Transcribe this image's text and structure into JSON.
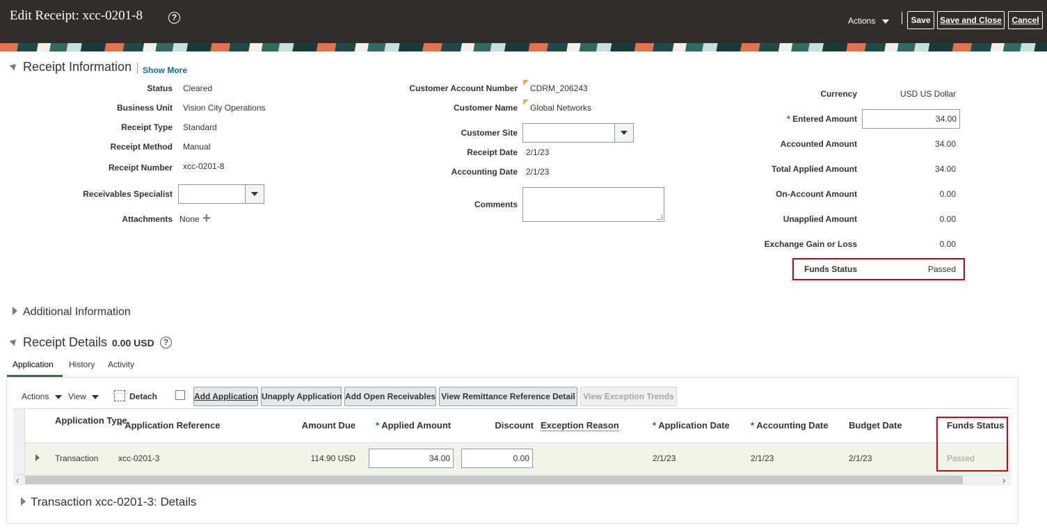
{
  "header": {
    "title": "Edit Receipt: xcc-0201-8",
    "actions_label": "Actions",
    "save_label": "Save",
    "save_close_label": "Save and Close",
    "cancel_label": "Cancel"
  },
  "receipt_info": {
    "title": "Receipt Information",
    "show_more": "Show More",
    "left": [
      {
        "label": "Status",
        "value": "Cleared"
      },
      {
        "label": "Business Unit",
        "value": "Vision City Operations"
      },
      {
        "label": "Receipt Type",
        "value": "Standard"
      },
      {
        "label": "Receipt Method",
        "value": "Manual"
      },
      {
        "label": "Receipt Number",
        "value": "xcc-0201-8"
      }
    ],
    "receivables_specialist": {
      "label": "Receivables Specialist",
      "value": ""
    },
    "attachments": {
      "label": "Attachments",
      "value": "None"
    },
    "middle": {
      "customer_account_number": {
        "label": "Customer Account Number",
        "value": "CDRM_206243"
      },
      "customer_name": {
        "label": "Customer Name",
        "value": "Global Networks"
      },
      "customer_site": {
        "label": "Customer Site",
        "value": ""
      },
      "receipt_date": {
        "label": "Receipt Date",
        "value": "2/1/23"
      },
      "accounting_date": {
        "label": "Accounting Date",
        "value": "2/1/23"
      },
      "comments": {
        "label": "Comments",
        "value": ""
      }
    },
    "right": {
      "currency": {
        "label": "Currency",
        "value": "USD US Dollar"
      },
      "entered_amount": {
        "label": "Entered Amount",
        "value": "34.00",
        "required_mark": "*"
      },
      "accounted_amount": {
        "label": "Accounted Amount",
        "value": "34.00"
      },
      "total_applied_amount": {
        "label": "Total Applied Amount",
        "value": "34.00"
      },
      "on_account_amount": {
        "label": "On-Account Amount",
        "value": "0.00"
      },
      "unapplied_amount": {
        "label": "Unapplied Amount",
        "value": "0.00"
      },
      "exchange_gain_loss": {
        "label": "Exchange Gain or Loss",
        "value": "0.00"
      },
      "funds_status": {
        "label": "Funds Status",
        "value": "Passed"
      }
    }
  },
  "additional_info": {
    "title": "Additional Information"
  },
  "receipt_details": {
    "title": "Receipt Details",
    "amount": "0.00 USD",
    "tabs": [
      "Application",
      "History",
      "Activity"
    ],
    "toolbar": {
      "actions": "Actions",
      "view": "View",
      "detach": "Detach",
      "add_application": "Add Application",
      "unapply_application": "Unapply Application",
      "add_open_receivables": "Add Open Receivables",
      "view_remittance": "View Remittance Reference Detail",
      "view_exception_trends": "View Exception Trends"
    },
    "columns": {
      "application_type": "Application Type",
      "application_reference": "Application Reference",
      "amount_due": "Amount Due",
      "applied_amount": "Applied Amount",
      "discount": "Discount",
      "exception_reason": "Exception Reason",
      "application_date": "Application Date",
      "accounting_date": "Accounting Date",
      "budget_date": "Budget Date",
      "funds_status": "Funds Status",
      "required_mark": "*"
    },
    "rows": [
      {
        "application_type": "Transaction",
        "application_reference": "xcc-0201-3",
        "amount_due": "114.90 USD",
        "applied_amount": "34.00",
        "discount": "0.00",
        "exception_reason": "",
        "application_date": "2/1/23",
        "accounting_date": "2/1/23",
        "budget_date": "2/1/23",
        "funds_status": "Passed"
      }
    ]
  },
  "transaction_details": {
    "title": "Transaction xcc-0201-3: Details"
  },
  "colors": {
    "header_bg": "#312d2a",
    "link": "#0a6b9e",
    "highlight": "#d1000c",
    "row_bg": "#f3f4e8"
  }
}
